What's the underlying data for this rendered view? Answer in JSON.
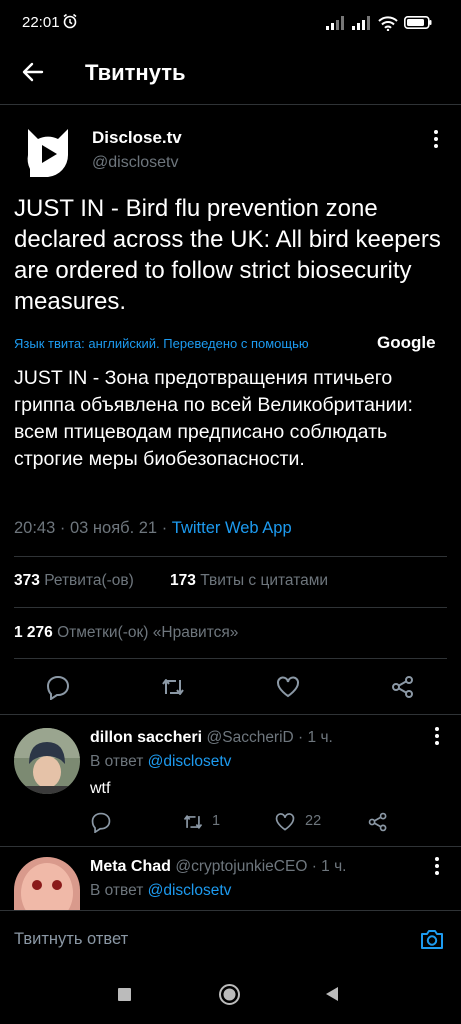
{
  "status_bar": {
    "time": "22:01"
  },
  "header": {
    "title": "Твитнуть"
  },
  "tweet": {
    "author_name": "Disclose.tv",
    "author_handle": "@disclosetv",
    "text": "JUST IN - Bird flu prevention zone declared across the UK: All bird keepers are ordered to follow strict biosecurity measures.",
    "translation_note": "Язык твита: английский. Переведено с помощью",
    "translation_provider": "Google",
    "translated_text": "JUST IN - Зона предотвращения птичьего гриппа объявлена по всей Великобритании: всем птицеводам предписано соблюдать строгие меры биобезопасности.",
    "time": "20:43",
    "date": "03 нояб. 21",
    "source": "Twitter Web App",
    "retweets_count": "373",
    "retweets_label": "Ретвита(-ов)",
    "quotes_count": "173",
    "quotes_label": "Твиты с цитатами",
    "likes_count": "1 276",
    "likes_label": "Отметки(-ок) «Нравится»"
  },
  "replies": [
    {
      "name": "dillon saccheri",
      "handle": "@SaccheriD",
      "time": "1 ч.",
      "reply_to_prefix": "В ответ",
      "reply_to": "@disclosetv",
      "text": "wtf",
      "retweets": "1",
      "likes": "22"
    },
    {
      "name": "Meta Chad",
      "handle": "@cryptojunkieCEO",
      "time": "1 ч.",
      "reply_to_prefix": "В ответ",
      "reply_to": "@disclosetv"
    }
  ],
  "compose": {
    "placeholder": "Твитнуть ответ"
  },
  "colors": {
    "accent": "#1d9bf0",
    "muted": "#6e767d",
    "divider": "#2f3336",
    "background": "#000000"
  },
  "icons": [
    "alarm-icon",
    "back-arrow-icon",
    "disclose-logo-icon",
    "more-icon",
    "reply-icon",
    "retweet-icon",
    "like-icon",
    "share-icon",
    "camera-icon",
    "nav-square-icon",
    "nav-home-icon",
    "nav-back-icon"
  ]
}
